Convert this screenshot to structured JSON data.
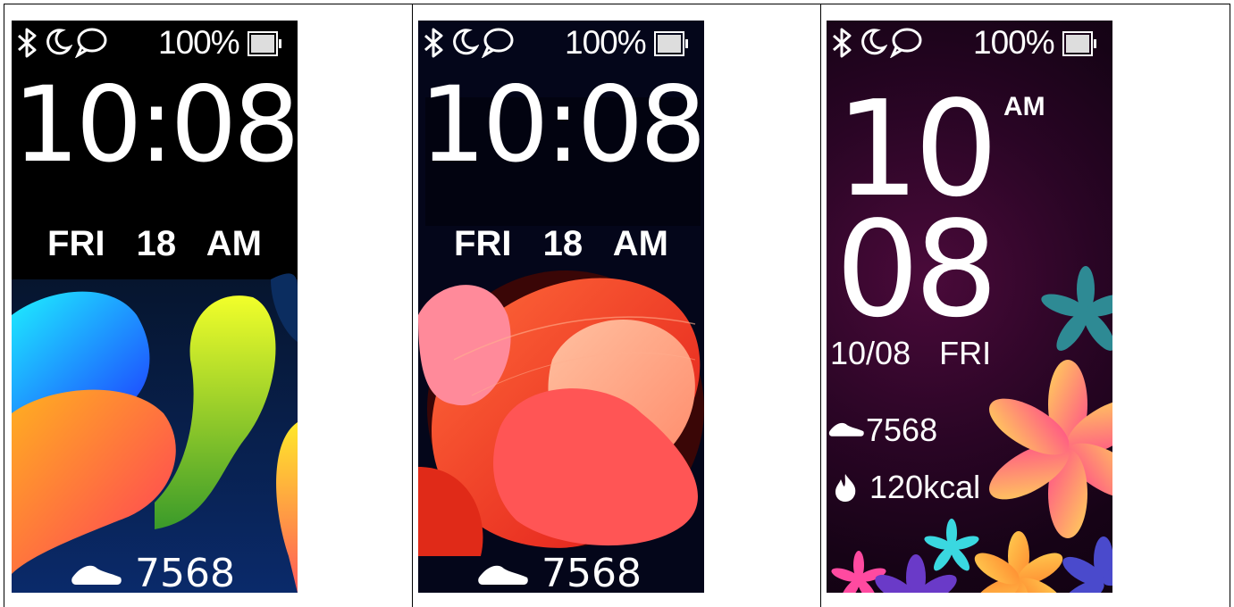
{
  "faces": [
    {
      "status": {
        "battery": "100%"
      },
      "time": "10:08",
      "date": {
        "day": "FRI",
        "num": "18",
        "ampm": "AM"
      },
      "steps": "7568"
    },
    {
      "status": {
        "battery": "100%"
      },
      "time": "10:08",
      "date": {
        "day": "FRI",
        "num": "18",
        "ampm": "AM"
      },
      "steps": "7568"
    },
    {
      "status": {
        "battery": "100%"
      },
      "hour": "10",
      "minute": "08",
      "ampm": "AM",
      "date": "10/08",
      "day": "FRI",
      "steps": "7568",
      "calories": "120kcal"
    }
  ],
  "icons": [
    "bluetooth-icon",
    "moon-icon",
    "message-icon",
    "battery-icon",
    "shoe-icon",
    "flame-icon"
  ]
}
